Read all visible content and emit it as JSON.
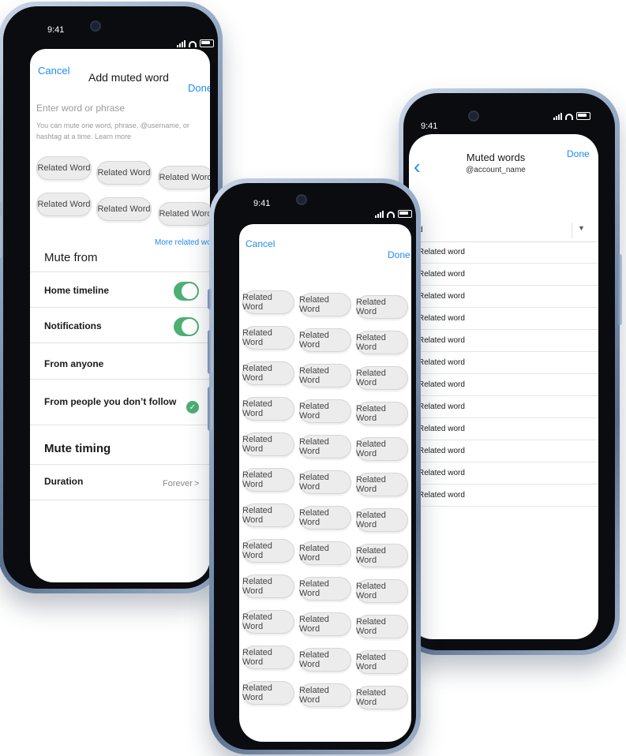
{
  "phone1": {
    "time": "9:41",
    "cancel": "Cancel",
    "title": "Add muted word",
    "done": "Done",
    "placeholder": "Enter word or phrase",
    "help": "You can mute one word, phrase, @username, or hashtag at a time. Learn more",
    "chips": [
      "Related Word",
      "Related Word",
      "Related Word",
      "Related Word",
      "Related Word",
      "Related Word"
    ],
    "more_related": "More related words",
    "mute_from": "Mute from",
    "home_timeline": "Home timeline",
    "notifications": "Notifications",
    "from_anyone": "From anyone",
    "from_people": "From people you don’t follow",
    "mute_timing": "Mute timing",
    "duration": "Duration",
    "duration_value": "Forever",
    "chevron": ">"
  },
  "phone2": {
    "time": "9:41",
    "cancel": "Cancel",
    "done": "Done",
    "chip_label": "Related Word"
  },
  "phone3": {
    "time": "9:41",
    "title": "Muted words",
    "account": "@account_name",
    "done": "Done",
    "dropdown_value": "d",
    "items": [
      "Related word",
      "Related word",
      "Related word",
      "Related word",
      "Related word",
      "Related word",
      "Related word",
      "Related word",
      "Related word",
      "Related word",
      "Related word",
      "Related word"
    ]
  },
  "colors": {
    "accent": "#1d8cf0",
    "toggle_on": "#4caf73"
  }
}
